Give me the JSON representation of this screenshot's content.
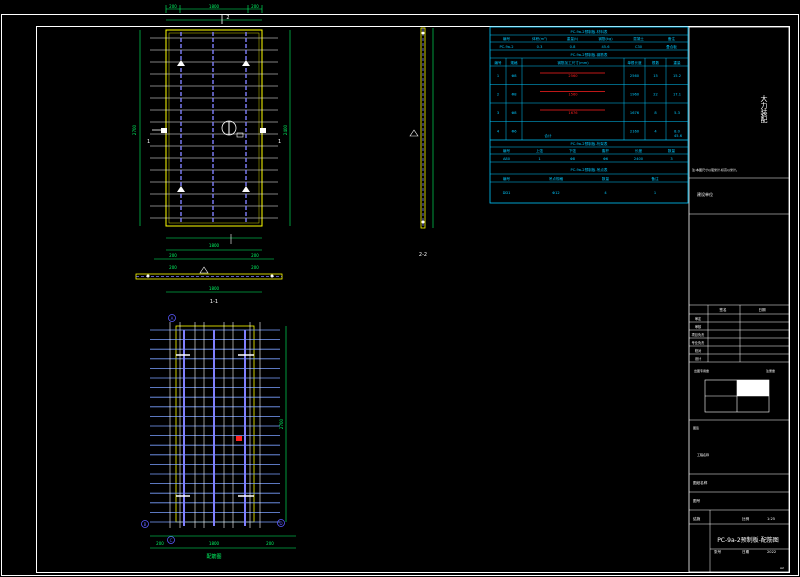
{
  "colors": {
    "background": "#000000",
    "frame": "#ffffff",
    "slab_outline": "#ffff00",
    "rebar_blue": "#5b5bff",
    "rebar_white": "#ffffff",
    "dimension": "#00ff66",
    "table_cyan": "#00c8ff",
    "highlight_red": "#ff2020",
    "truss": "#8080ff"
  },
  "drawing": {
    "section_label_11": "1-1",
    "section_label_22": "2-2",
    "plan_label": "配筋图",
    "dims": {
      "top_left": "200",
      "top_mid": "1800",
      "top_right": "200",
      "top_mark": "2",
      "plan_bottom": "1800",
      "plan_bottom_left": "200",
      "plan_bottom_right": "200",
      "section_len": "1800",
      "section_left": "200",
      "section_right": "200",
      "height_total": "2700",
      "height_right": "2400",
      "height_left_mark": "1",
      "right_mark": "1",
      "rebar_bottom": "1800",
      "rebar_bottom_l": "200",
      "rebar_bottom_r": "200",
      "rebar_height": "2700",
      "circle_a": "A",
      "circle_b": "B",
      "circle_c": "C",
      "circle_d": "D"
    }
  },
  "table": {
    "title1": "PC-9a-2预制板-材料表",
    "header1": [
      "编号",
      "体积(m³)",
      "重量(t)",
      "钢筋(kg)",
      "混凝土",
      "备注"
    ],
    "row1": [
      "PC-9a-2",
      "0.3",
      "0.8",
      "45.6",
      "C30",
      "叠合板"
    ],
    "title2": "PC-9a-2预制板-钢筋表",
    "header2": [
      "编号",
      "规格",
      "钢筋加工尺寸(mm)",
      "单根长度",
      "根数",
      "重量"
    ],
    "rows2": [
      [
        "1",
        "Φ8",
        "2560",
        "2560",
        "15",
        "15.2"
      ],
      [
        "2",
        "Φ8",
        "1560",
        "1960",
        "22",
        "17.1"
      ],
      [
        "3",
        "Φ8",
        "1676",
        "1676",
        "8",
        "5.3"
      ],
      [
        "4",
        "Φ6",
        "",
        "2160",
        "4",
        "8.0"
      ]
    ],
    "total_label": "合计",
    "total_value": "45.6",
    "title3": "PC-9a-2预制板-桁架表",
    "header3": [
      "编号",
      "上弦",
      "下弦",
      "腹杆",
      "长度",
      "数量"
    ],
    "row3": [
      "A80",
      "1",
      "Φ8",
      "Φ6",
      "2400",
      "3"
    ],
    "title4": "PC-9a-2预制板-吊点表",
    "header4": [
      "编号",
      "吊点规格",
      "数量",
      "备注"
    ],
    "row4": [
      "DD1",
      "Φ12",
      "4",
      "1"
    ]
  },
  "title_block": {
    "company": "大力装配",
    "note": "注:本图尺寸以毫米计,标高以米计。",
    "project_label": "建设单位",
    "rows": [
      "审定",
      "审核",
      "项目负责",
      "专业负责",
      "校对",
      "设计"
    ],
    "col_header_a": "签名",
    "col_header_b": "日期",
    "stamp_label": "出图专用章",
    "stamp_label2": "注册章",
    "seal_label": "图签",
    "project_name_label": "工程名称",
    "drawing_name_label": "图纸名称",
    "drawing_no_label": "图号",
    "scale_label": "比例",
    "scale_value": "1:25",
    "drawing_title": "PC-9a-2预制板-配筋图",
    "date_label": "日期",
    "date_value": "2022",
    "sheet_label": "张号",
    "code_label": "结施",
    "corner_mark": "A2"
  }
}
